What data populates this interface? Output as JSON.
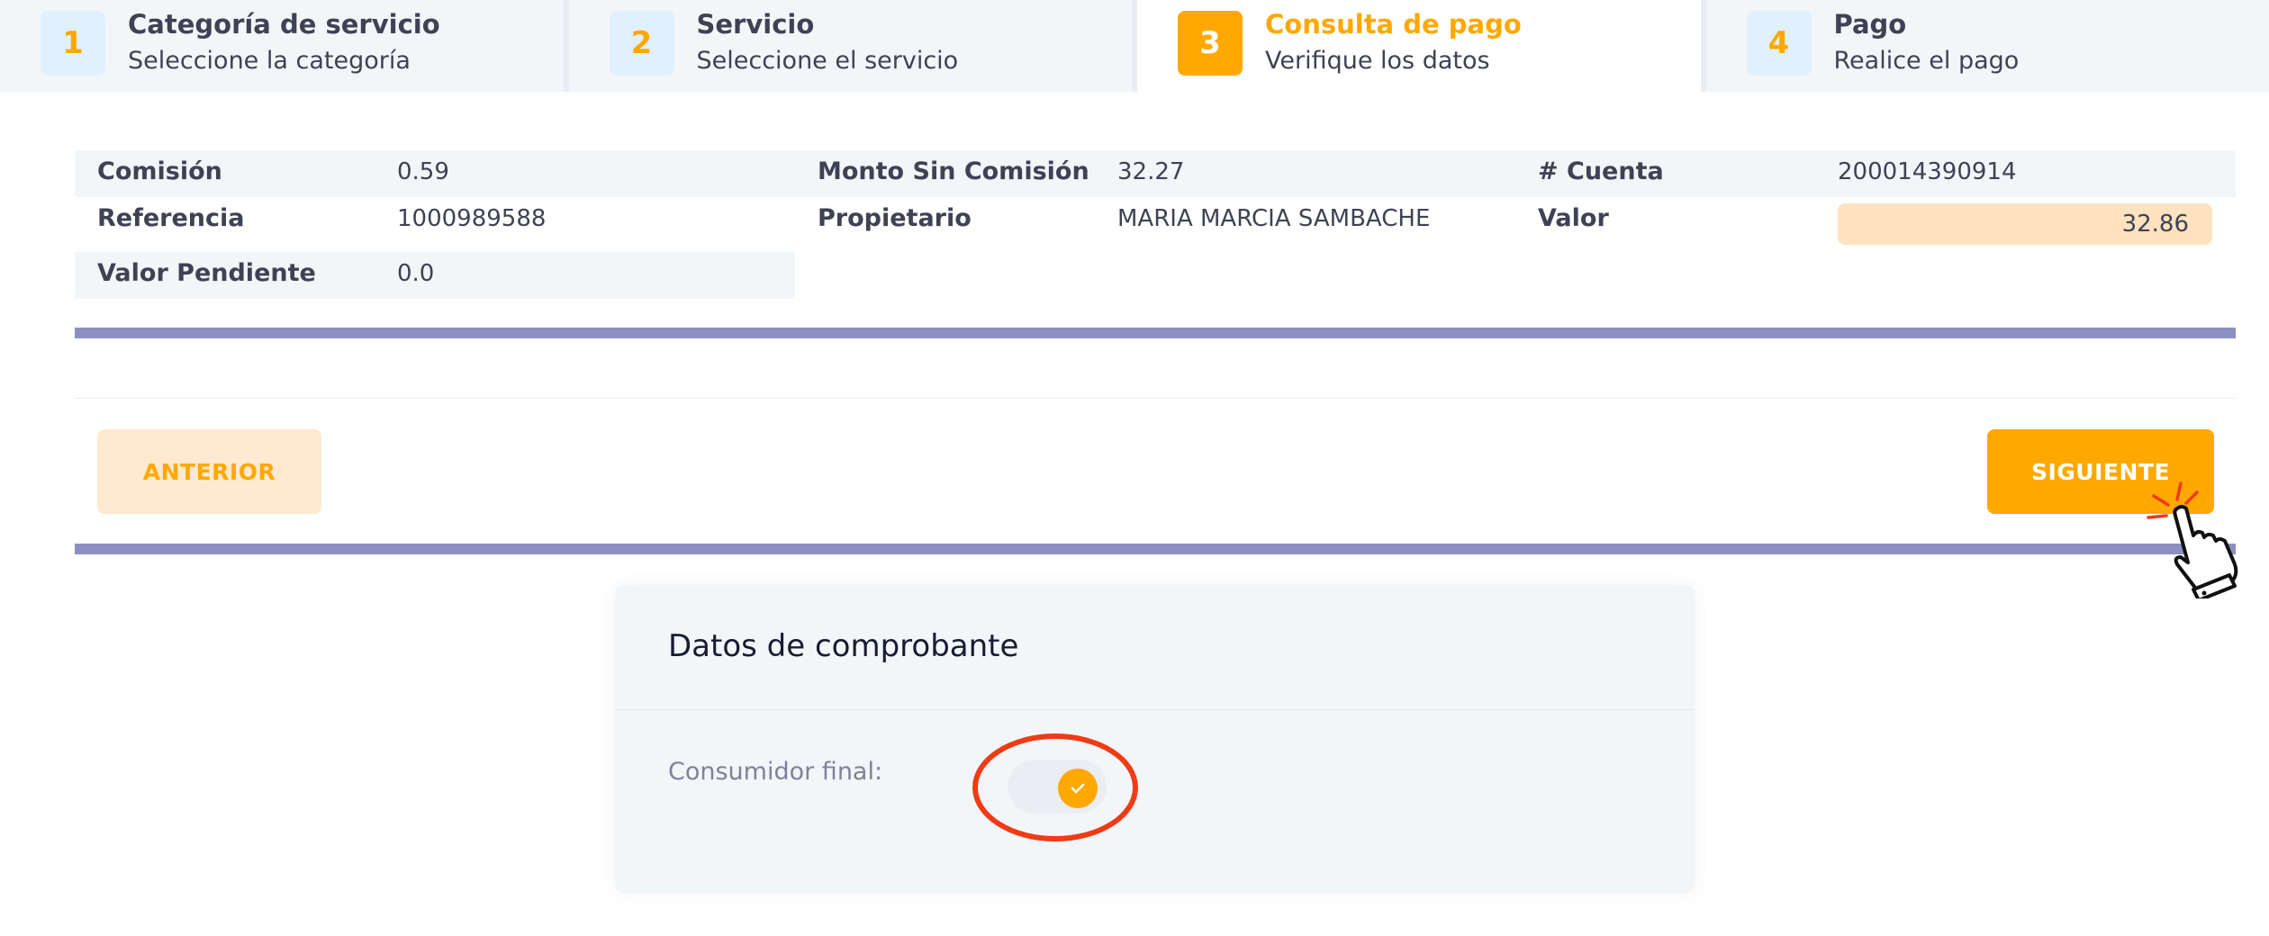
{
  "stepper": {
    "steps": [
      {
        "number": "1",
        "title": "Categoría de servicio",
        "subtitle": "Seleccione la categoría"
      },
      {
        "number": "2",
        "title": "Servicio",
        "subtitle": "Seleccione el servicio"
      },
      {
        "number": "3",
        "title": "Consulta de pago",
        "subtitle": "Verifique los datos",
        "active": true
      },
      {
        "number": "4",
        "title": "Pago",
        "subtitle": "Realice el pago"
      }
    ]
  },
  "details": {
    "comision": {
      "label": "Comisión",
      "value": "0.59"
    },
    "monto_sin_comision": {
      "label": "Monto Sin Comisión",
      "value": "32.27"
    },
    "cuenta": {
      "label": "# Cuenta",
      "value": "200014390914"
    },
    "referencia": {
      "label": "Referencia",
      "value": "1000989588"
    },
    "propietario": {
      "label": "Propietario",
      "value": "MARIA MARCIA SAMBACHE"
    },
    "valor": {
      "label": "Valor",
      "value": "32.86"
    },
    "valor_pendiente": {
      "label": "Valor Pendiente",
      "value": "0.0"
    }
  },
  "buttons": {
    "previous": "ANTERIOR",
    "next": "SIGUIENTE"
  },
  "comprobante": {
    "title": "Datos de comprobante",
    "consumidor_final_label": "Consumidor final:",
    "consumidor_final_checked": true
  },
  "colors": {
    "accent": "#ffa800",
    "divider_bar": "#8c8fc2",
    "highlight_circle": "#ef3b16"
  },
  "icons": {
    "toggle_knob": "check-icon",
    "pointer": "hand-pointer-icon"
  }
}
